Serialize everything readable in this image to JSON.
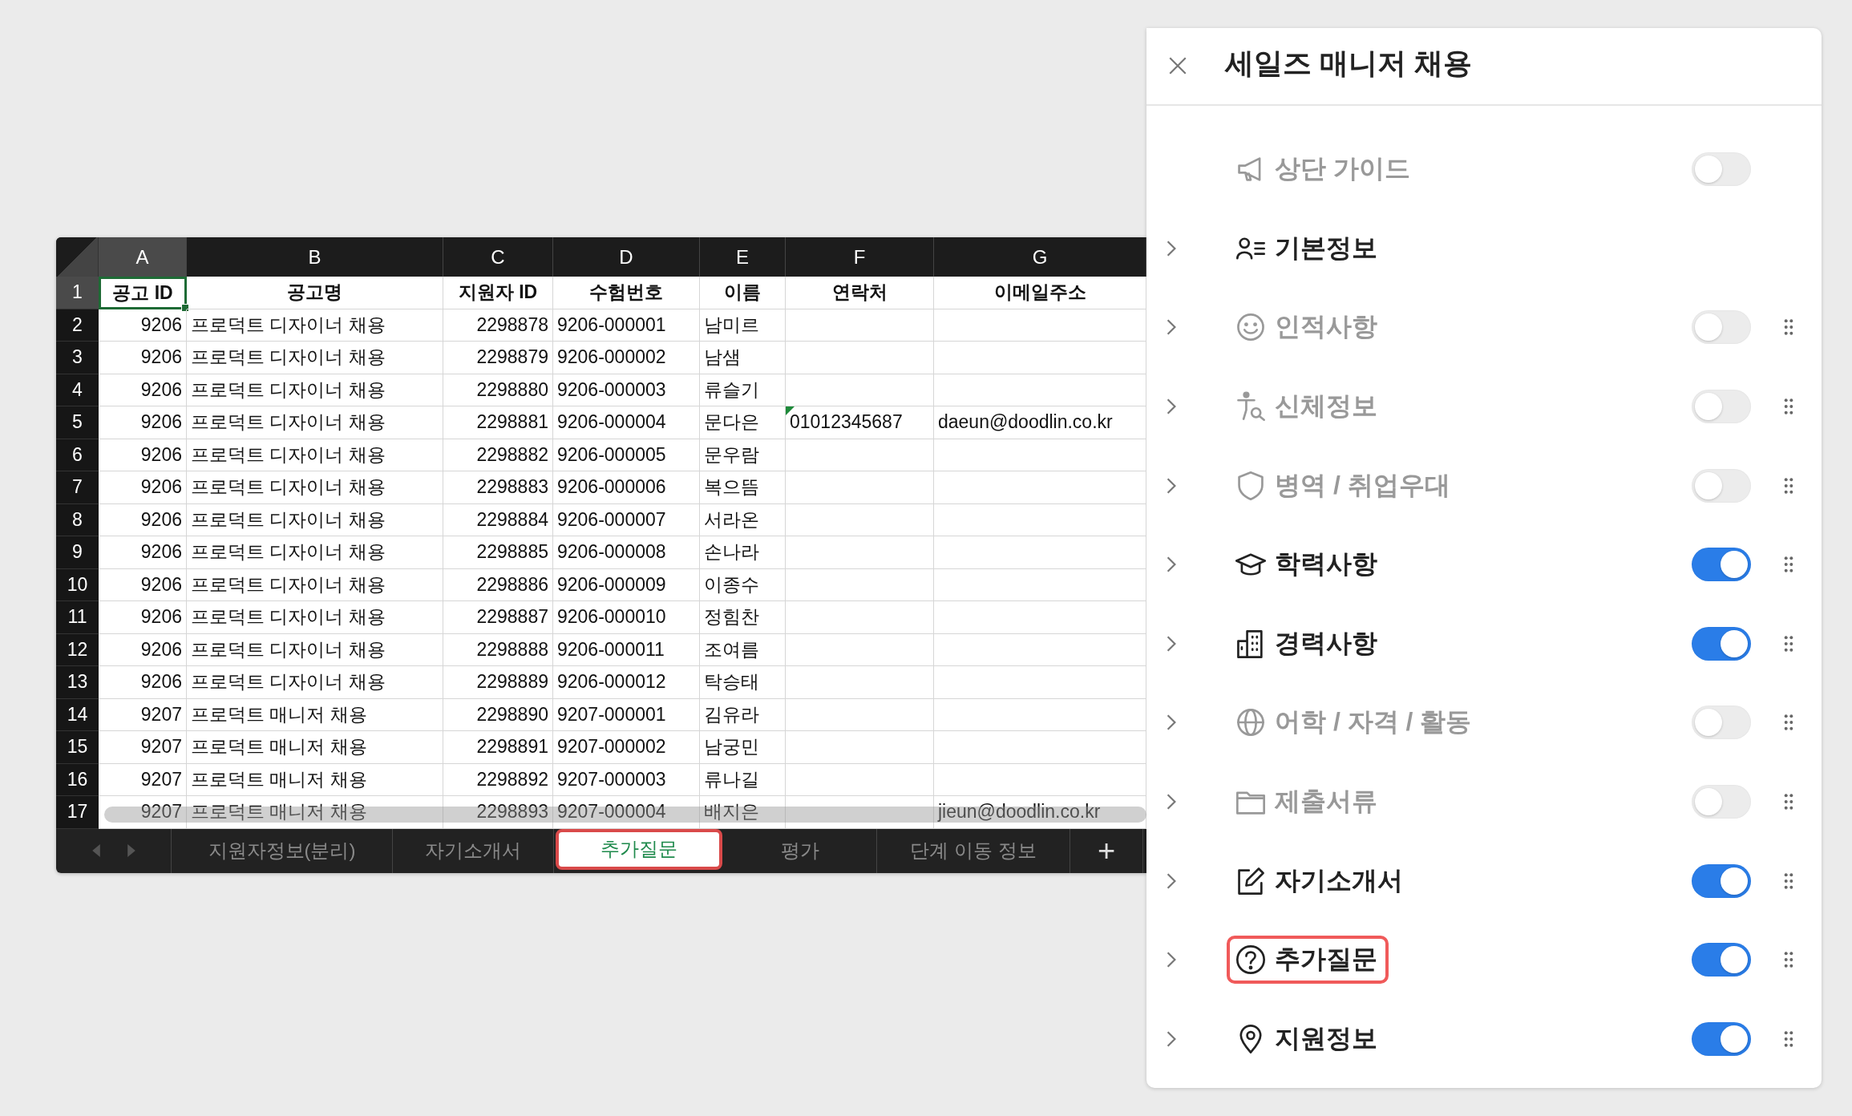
{
  "sheet": {
    "columns": [
      {
        "letter": "A",
        "selected": true,
        "numeric": true
      },
      {
        "letter": "B",
        "selected": false,
        "numeric": false
      },
      {
        "letter": "C",
        "selected": false,
        "numeric": true
      },
      {
        "letter": "D",
        "selected": false,
        "numeric": false
      },
      {
        "letter": "E",
        "selected": false,
        "numeric": false
      },
      {
        "letter": "F",
        "selected": false,
        "numeric": false
      },
      {
        "letter": "G",
        "selected": false,
        "numeric": false
      }
    ],
    "rows": [
      {
        "number": "1",
        "kind": "header",
        "selected": true,
        "cells": [
          {
            "text": "공고 ID",
            "flag": false
          },
          {
            "text": "공고명",
            "flag": false
          },
          {
            "text": "지원자 ID",
            "flag": false
          },
          {
            "text": "수험번호",
            "flag": false
          },
          {
            "text": "이름",
            "flag": false
          },
          {
            "text": "연락처",
            "flag": false
          },
          {
            "text": "이메일주소",
            "flag": false
          }
        ]
      },
      {
        "number": "2",
        "kind": "data",
        "selected": false,
        "cells": [
          {
            "text": "9206",
            "flag": false
          },
          {
            "text": "프로덕트 디자이너 채용",
            "flag": false
          },
          {
            "text": "2298878",
            "flag": false
          },
          {
            "text": "9206-000001",
            "flag": false
          },
          {
            "text": "남미르",
            "flag": false
          },
          {
            "flag": false
          },
          {
            "flag": false
          }
        ]
      },
      {
        "number": "3",
        "kind": "data",
        "selected": false,
        "cells": [
          {
            "text": "9206",
            "flag": false
          },
          {
            "text": "프로덕트 디자이너 채용",
            "flag": false
          },
          {
            "text": "2298879",
            "flag": false
          },
          {
            "text": "9206-000002",
            "flag": false
          },
          {
            "text": "남샘",
            "flag": false
          },
          {
            "flag": false
          },
          {
            "flag": false
          }
        ]
      },
      {
        "number": "4",
        "kind": "data",
        "selected": false,
        "cells": [
          {
            "text": "9206",
            "flag": false
          },
          {
            "text": "프로덕트 디자이너 채용",
            "flag": false
          },
          {
            "text": "2298880",
            "flag": false
          },
          {
            "text": "9206-000003",
            "flag": false
          },
          {
            "text": "류슬기",
            "flag": false
          },
          {
            "flag": false
          },
          {
            "flag": false
          }
        ]
      },
      {
        "number": "5",
        "kind": "data",
        "selected": false,
        "cells": [
          {
            "text": "9206",
            "flag": false
          },
          {
            "text": "프로덕트 디자이너 채용",
            "flag": false
          },
          {
            "text": "2298881",
            "flag": false
          },
          {
            "text": "9206-000004",
            "flag": false
          },
          {
            "text": "문다은",
            "flag": false
          },
          {
            "text": "01012345687",
            "flag": true
          },
          {
            "text": "daeun@doodlin.co.kr",
            "flag": false
          }
        ]
      },
      {
        "number": "6",
        "kind": "data",
        "selected": false,
        "cells": [
          {
            "text": "9206",
            "flag": false
          },
          {
            "text": "프로덕트 디자이너 채용",
            "flag": false
          },
          {
            "text": "2298882",
            "flag": false
          },
          {
            "text": "9206-000005",
            "flag": false
          },
          {
            "text": "문우람",
            "flag": false
          },
          {
            "flag": false
          },
          {
            "flag": false
          }
        ]
      },
      {
        "number": "7",
        "kind": "data",
        "selected": false,
        "cells": [
          {
            "text": "9206",
            "flag": false
          },
          {
            "text": "프로덕트 디자이너 채용",
            "flag": false
          },
          {
            "text": "2298883",
            "flag": false
          },
          {
            "text": "9206-000006",
            "flag": false
          },
          {
            "text": "복으뜸",
            "flag": false
          },
          {
            "flag": false
          },
          {
            "flag": false
          }
        ]
      },
      {
        "number": "8",
        "kind": "data",
        "selected": false,
        "cells": [
          {
            "text": "9206",
            "flag": false
          },
          {
            "text": "프로덕트 디자이너 채용",
            "flag": false
          },
          {
            "text": "2298884",
            "flag": false
          },
          {
            "text": "9206-000007",
            "flag": false
          },
          {
            "text": "서라온",
            "flag": false
          },
          {
            "flag": false
          },
          {
            "flag": false
          }
        ]
      },
      {
        "number": "9",
        "kind": "data",
        "selected": false,
        "cells": [
          {
            "text": "9206",
            "flag": false
          },
          {
            "text": "프로덕트 디자이너 채용",
            "flag": false
          },
          {
            "text": "2298885",
            "flag": false
          },
          {
            "text": "9206-000008",
            "flag": false
          },
          {
            "text": "손나라",
            "flag": false
          },
          {
            "flag": false
          },
          {
            "flag": false
          }
        ]
      },
      {
        "number": "10",
        "kind": "data",
        "selected": false,
        "cells": [
          {
            "text": "9206",
            "flag": false
          },
          {
            "text": "프로덕트 디자이너 채용",
            "flag": false
          },
          {
            "text": "2298886",
            "flag": false
          },
          {
            "text": "9206-000009",
            "flag": false
          },
          {
            "text": "이종수",
            "flag": false
          },
          {
            "flag": false
          },
          {
            "flag": false
          }
        ]
      },
      {
        "number": "11",
        "kind": "data",
        "selected": false,
        "cells": [
          {
            "text": "9206",
            "flag": false
          },
          {
            "text": "프로덕트 디자이너 채용",
            "flag": false
          },
          {
            "text": "2298887",
            "flag": false
          },
          {
            "text": "9206-000010",
            "flag": false
          },
          {
            "text": "정힘찬",
            "flag": false
          },
          {
            "flag": false
          },
          {
            "flag": false
          }
        ]
      },
      {
        "number": "12",
        "kind": "data",
        "selected": false,
        "cells": [
          {
            "text": "9206",
            "flag": false
          },
          {
            "text": "프로덕트 디자이너 채용",
            "flag": false
          },
          {
            "text": "2298888",
            "flag": false
          },
          {
            "text": "9206-000011",
            "flag": false
          },
          {
            "text": "조여름",
            "flag": false
          },
          {
            "flag": false
          },
          {
            "flag": false
          }
        ]
      },
      {
        "number": "13",
        "kind": "data",
        "selected": false,
        "cells": [
          {
            "text": "9206",
            "flag": false
          },
          {
            "text": "프로덕트 디자이너 채용",
            "flag": false
          },
          {
            "text": "2298889",
            "flag": false
          },
          {
            "text": "9206-000012",
            "flag": false
          },
          {
            "text": "탁승태",
            "flag": false
          },
          {
            "flag": false
          },
          {
            "flag": false
          }
        ]
      },
      {
        "number": "14",
        "kind": "data",
        "selected": false,
        "cells": [
          {
            "text": "9207",
            "flag": false
          },
          {
            "text": "프로덕트 매니저 채용",
            "flag": false
          },
          {
            "text": "2298890",
            "flag": false
          },
          {
            "text": "9207-000001",
            "flag": false
          },
          {
            "text": "김유라",
            "flag": false
          },
          {
            "flag": false
          },
          {
            "flag": false
          }
        ]
      },
      {
        "number": "15",
        "kind": "data",
        "selected": false,
        "cells": [
          {
            "text": "9207",
            "flag": false
          },
          {
            "text": "프로덕트 매니저 채용",
            "flag": false
          },
          {
            "text": "2298891",
            "flag": false
          },
          {
            "text": "9207-000002",
            "flag": false
          },
          {
            "text": "남궁민",
            "flag": false
          },
          {
            "flag": false
          },
          {
            "flag": false
          }
        ]
      },
      {
        "number": "16",
        "kind": "data",
        "selected": false,
        "cells": [
          {
            "text": "9207",
            "flag": false
          },
          {
            "text": "프로덕트 매니저 채용",
            "flag": false
          },
          {
            "text": "2298892",
            "flag": false
          },
          {
            "text": "9207-000003",
            "flag": false
          },
          {
            "text": "류나길",
            "flag": false
          },
          {
            "flag": false
          },
          {
            "flag": false
          }
        ]
      },
      {
        "number": "17",
        "kind": "data",
        "selected": false,
        "cells": [
          {
            "text": "9207",
            "flag": false
          },
          {
            "text": "프로덕트 매니저 채용",
            "flag": false
          },
          {
            "text": "2298893",
            "flag": false
          },
          {
            "text": "9207-000004",
            "flag": false
          },
          {
            "text": "배지은",
            "flag": false
          },
          {
            "flag": false
          },
          {
            "text": "jieun@doodlin.co.kr",
            "flag": false
          }
        ]
      }
    ],
    "tabs": [
      {
        "label": "지원자정보(분리)",
        "selected": false,
        "highlighted": false
      },
      {
        "label": "자기소개서",
        "selected": false,
        "highlighted": false
      },
      {
        "label": "추가질문",
        "selected": true,
        "highlighted": true
      },
      {
        "label": "평가",
        "selected": false,
        "highlighted": false
      },
      {
        "label": "단계 이동 정보",
        "selected": false,
        "highlighted": false
      }
    ],
    "add_tab": "+"
  },
  "panel": {
    "title": "세일즈 매니저 채용",
    "items": [
      {
        "label": "상단 가이드",
        "kind": "toggle",
        "on": false,
        "expandable": false,
        "draggable": false,
        "highlighted": false
      },
      {
        "label": "기본정보",
        "kind": "fixed",
        "expandable": true,
        "draggable": false,
        "highlighted": false
      },
      {
        "label": "인적사항",
        "kind": "toggle",
        "on": false,
        "expandable": true,
        "draggable": true,
        "highlighted": false
      },
      {
        "label": "신체정보",
        "kind": "toggle",
        "on": false,
        "expandable": true,
        "draggable": true,
        "highlighted": false
      },
      {
        "label": "병역 / 취업우대",
        "kind": "toggle",
        "on": false,
        "expandable": true,
        "draggable": true,
        "highlighted": false
      },
      {
        "label": "학력사항",
        "kind": "toggle",
        "on": true,
        "expandable": true,
        "draggable": true,
        "highlighted": false
      },
      {
        "label": "경력사항",
        "kind": "toggle",
        "on": true,
        "expandable": true,
        "draggable": true,
        "highlighted": false
      },
      {
        "label": "어학 / 자격 / 활동",
        "kind": "toggle",
        "on": false,
        "expandable": true,
        "draggable": true,
        "highlighted": false
      },
      {
        "label": "제출서류",
        "kind": "toggle",
        "on": false,
        "expandable": true,
        "draggable": true,
        "highlighted": false
      },
      {
        "label": "자기소개서",
        "kind": "toggle",
        "on": true,
        "expandable": true,
        "draggable": true,
        "highlighted": false
      },
      {
        "label": "추가질문",
        "kind": "toggle",
        "on": true,
        "expandable": true,
        "draggable": true,
        "highlighted": true
      },
      {
        "label": "지원정보",
        "kind": "toggle",
        "on": true,
        "expandable": true,
        "draggable": true,
        "highlighted": false
      }
    ]
  }
}
